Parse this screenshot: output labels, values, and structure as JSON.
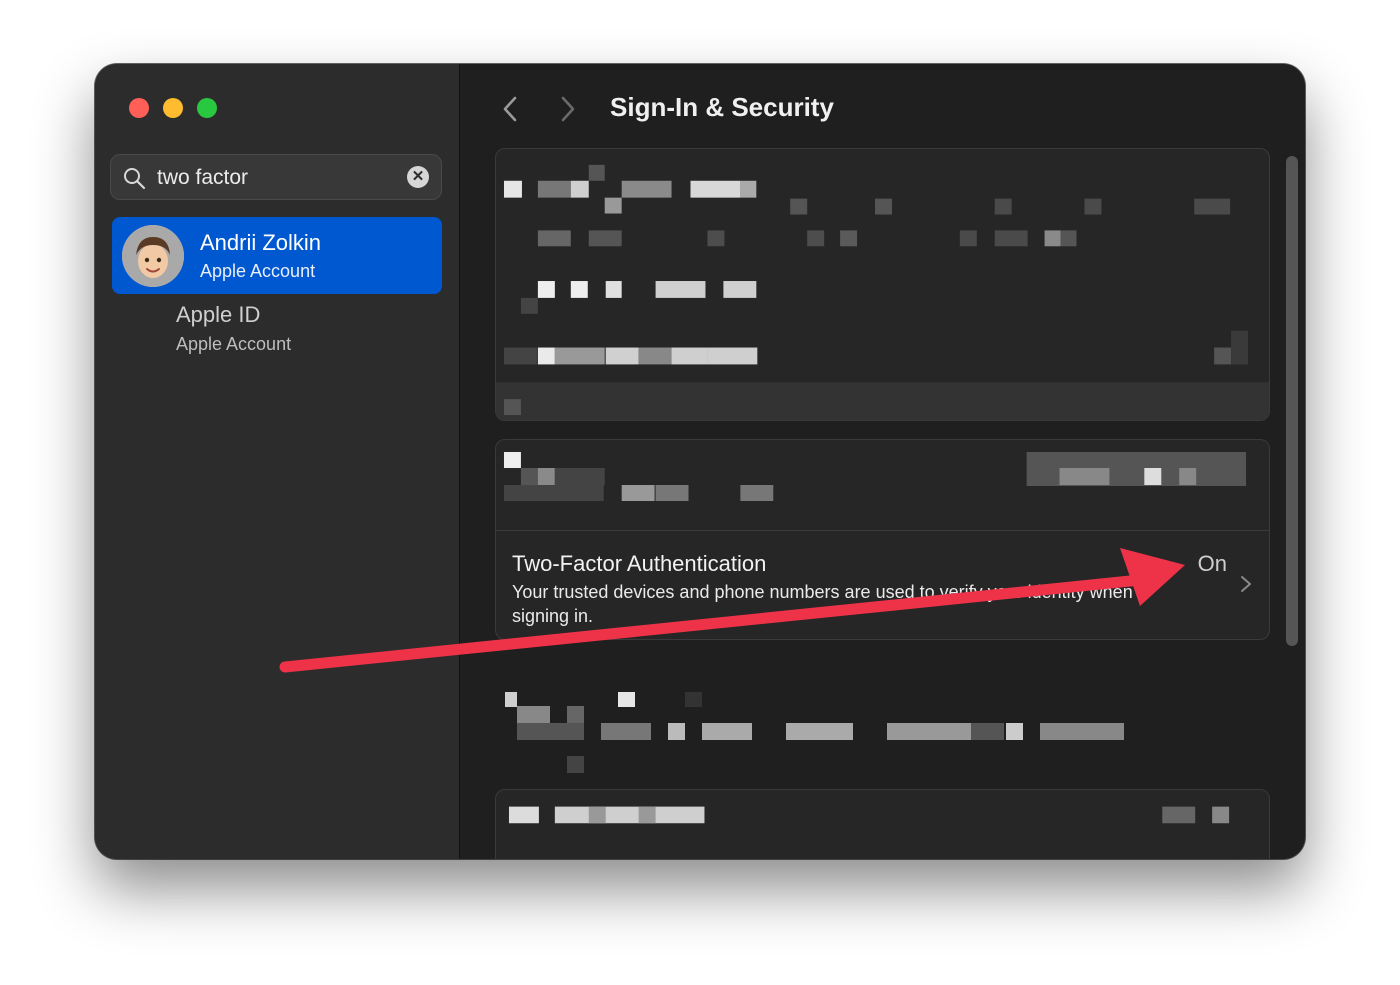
{
  "window": {
    "title": "Sign-In & Security"
  },
  "search": {
    "query": "two factor",
    "clear_glyph": "✕"
  },
  "sidebar": {
    "accounts": [
      {
        "name": "Andrii Zolkin",
        "subtitle": "Apple Account",
        "selected": true
      },
      {
        "name": "Apple ID",
        "subtitle": "Apple Account",
        "selected": false
      }
    ]
  },
  "two_factor": {
    "title": "Two-Factor Authentication",
    "description": "Your trusted devices and phone numbers are used to verify your identity when signing in.",
    "value": "On"
  },
  "icons": {
    "search": "search-icon",
    "clear": "clear-icon",
    "back": "chevron-left-icon",
    "forward": "chevron-right-icon",
    "disclosure": "chevron-right-icon",
    "annotation": "red-arrow-annotation"
  },
  "colors": {
    "accent": "#0058d1",
    "annotation": "#ee3349",
    "close": "#ff5f57",
    "minimize": "#febc2e",
    "zoom": "#28c840"
  }
}
